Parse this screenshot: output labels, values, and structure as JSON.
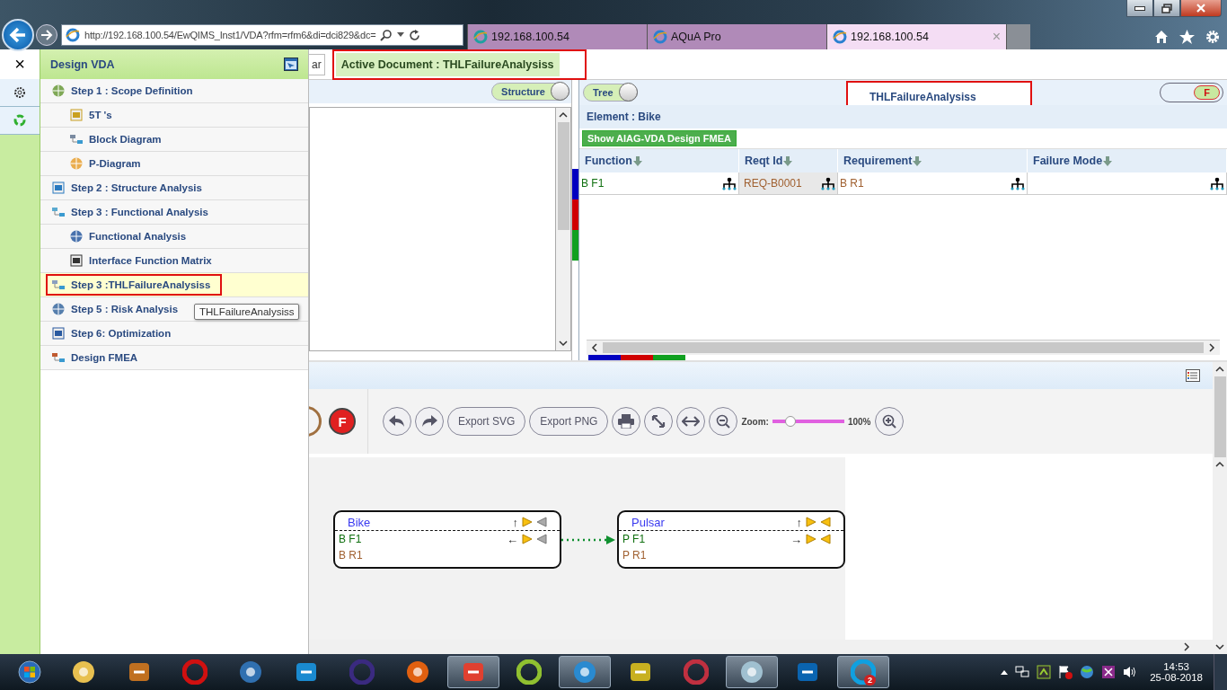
{
  "browser": {
    "address": "http://192.168.100.54/EwQIMS_Inst1/VDA?rfm=rfm6&di=dci829&dc=",
    "tabs": [
      {
        "label": "192.168.100.54",
        "selected": false
      },
      {
        "label": "AQuA Pro",
        "selected": false
      },
      {
        "label": "192.168.100.54",
        "selected": true,
        "close": "×"
      }
    ]
  },
  "sidebar": {
    "title": "Design VDA",
    "close": "×",
    "items": [
      {
        "label": "Step 1 : Scope Definition",
        "selected": false,
        "highlighted": false,
        "children": [
          {
            "label": "5T 's",
            "selected": false,
            "highlighted": false
          },
          {
            "label": "Block Diagram",
            "selected": false,
            "highlighted": false
          },
          {
            "label": "P-Diagram",
            "selected": false,
            "highlighted": false
          }
        ]
      },
      {
        "label": "Step 2 : Structure Analysis",
        "selected": false,
        "highlighted": false
      },
      {
        "label": "Step 3 : Functional Analysis",
        "selected": false,
        "highlighted": false,
        "children": [
          {
            "label": "Functional Analysis",
            "selected": false,
            "highlighted": false
          },
          {
            "label": "Interface Function Matrix",
            "selected": false,
            "highlighted": false
          }
        ]
      },
      {
        "label": "Step 3 :THLFailureAnalysiss",
        "selected": true,
        "highlighted": true
      },
      {
        "label": "Step 5 : Risk Analysis",
        "selected": false,
        "highlighted": false
      },
      {
        "label": "Step 6: Optimization",
        "selected": false,
        "highlighted": false
      },
      {
        "label": "Design FMEA",
        "selected": false,
        "highlighted": false
      }
    ],
    "tooltip": "THLFailureAnalysiss"
  },
  "top_bar": {
    "tab_fragment": "ar",
    "active_document": {
      "text": "Active Document : THLFailureAnalysiss",
      "highlighted": true
    }
  },
  "left_panel": {
    "toggle": "Structure"
  },
  "right_panel": {
    "toggle": "Tree",
    "title": {
      "text": "THLFailureAnalysiss",
      "highlighted": true
    },
    "mode_toggle": "F",
    "element": "Element : Bike",
    "action_button": "Show AIAG-VDA Design FMEA",
    "table": {
      "columns": [
        "Function",
        "Reqt Id",
        "Requirement",
        "Failure Mode"
      ],
      "rows": [
        {
          "cells": [
            {
              "text": "B F1"
            },
            {
              "text": "REQ-B0001"
            },
            {
              "text": "B R1"
            },
            {}
          ]
        }
      ]
    }
  },
  "diagram_toolbar": {
    "f_button": "F",
    "export_svg": "Export SVG",
    "export_png": "Export PNG",
    "zoom_label": "Zoom:",
    "zoom": {
      "level": 0.2
    },
    "zoom_reading": "100%"
  },
  "diagram": {
    "nodes": [
      {
        "title": "Bike",
        "header_arrow": "↑",
        "marker_on": false,
        "rows": [
          {
            "text": "B F1",
            "kind": "function",
            "arrow": "←"
          },
          {
            "text": "B R1",
            "kind": "requirement"
          }
        ]
      },
      {
        "title": "Pulsar",
        "header_arrow": "↑",
        "marker_on": true,
        "rows": [
          {
            "text": "P F1",
            "kind": "function",
            "arrow": "→"
          },
          {
            "text": "P R1",
            "kind": "requirement"
          }
        ]
      }
    ]
  },
  "taskbar": {
    "apps": [
      {
        "running": false
      },
      {
        "running": false
      },
      {
        "running": false
      },
      {
        "running": false
      },
      {
        "running": false
      },
      {
        "running": false
      },
      {
        "running": false
      },
      {
        "running": true
      },
      {
        "running": false
      },
      {
        "running": true
      },
      {
        "running": false
      },
      {
        "running": false
      },
      {
        "running": true
      },
      {
        "running": false
      },
      {
        "running": true,
        "badge": "2"
      }
    ],
    "time": "14:53",
    "date": "25-08-2018"
  }
}
